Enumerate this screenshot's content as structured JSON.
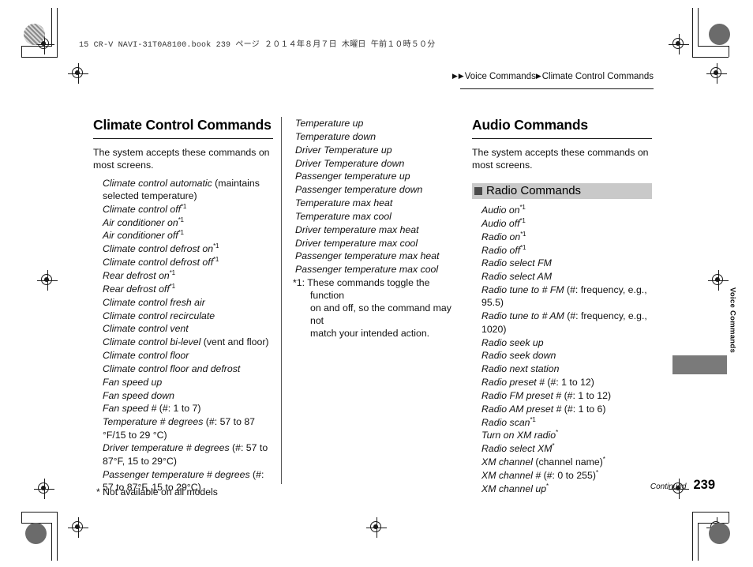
{
  "print_marks": {
    "filename_bar": "15 CR-V NAVI-31T0A8100.book   239 ページ   ２０１４年８月７日   木曜日   午前１０時５０分"
  },
  "breadcrumb": {
    "arrow": "▶",
    "parent": "Voice Commands",
    "current": "Climate Control Commands"
  },
  "side_tab": {
    "label": "Voice Commands"
  },
  "footer": {
    "continued": "Continued",
    "page_number": "239"
  },
  "bottom_note": "* Not available on all models",
  "columns": {
    "left": {
      "title": "Climate Control Commands",
      "intro": "The system accepts these commands on most screens.",
      "items": [
        {
          "cmd": "Climate control automatic",
          "note": " (maintains selected temperature)",
          "mark": ""
        },
        {
          "cmd": "Climate control off",
          "note": "",
          "mark": "*1"
        },
        {
          "cmd": "Air conditioner on",
          "note": "",
          "mark": "*1"
        },
        {
          "cmd": "Air conditioner off",
          "note": "",
          "mark": "*1"
        },
        {
          "cmd": "Climate control defrost on",
          "note": "",
          "mark": "*1"
        },
        {
          "cmd": "Climate control defrost off",
          "note": "",
          "mark": "*1"
        },
        {
          "cmd": "Rear defrost on",
          "note": "",
          "mark": "*1"
        },
        {
          "cmd": "Rear defrost off",
          "note": "",
          "mark": "*1"
        },
        {
          "cmd": "Climate control fresh air",
          "note": "",
          "mark": ""
        },
        {
          "cmd": "Climate control recirculate",
          "note": "",
          "mark": ""
        },
        {
          "cmd": "Climate control vent",
          "note": "",
          "mark": ""
        },
        {
          "cmd": "Climate control bi-level",
          "note": " (vent and floor)",
          "mark": ""
        },
        {
          "cmd": "Climate control floor",
          "note": "",
          "mark": ""
        },
        {
          "cmd": "Climate control floor and defrost",
          "note": "",
          "mark": ""
        },
        {
          "cmd": "Fan speed up",
          "note": "",
          "mark": ""
        },
        {
          "cmd": "Fan speed down",
          "note": "",
          "mark": ""
        },
        {
          "cmd": "Fan speed #",
          "note": " (#: 1 to 7)",
          "mark": ""
        },
        {
          "cmd": "Temperature # degrees",
          "note": " (#: 57 to 87 °F/15 to 29 °C)",
          "mark": ""
        },
        {
          "cmd": "Driver temperature # degrees",
          "note": " (#: 57 to 87°F, 15 to 29°C)",
          "mark": ""
        },
        {
          "cmd": "Passenger temperature # degrees",
          "note": " (#: 57 to 87°F, 15 to 29°C)",
          "mark": ""
        }
      ]
    },
    "middle": {
      "items": [
        {
          "cmd": "Temperature up",
          "note": "",
          "mark": ""
        },
        {
          "cmd": "Temperature down",
          "note": "",
          "mark": ""
        },
        {
          "cmd": "Driver Temperature up",
          "note": "",
          "mark": ""
        },
        {
          "cmd": "Driver Temperature down",
          "note": "",
          "mark": ""
        },
        {
          "cmd": "Passenger temperature up",
          "note": "",
          "mark": ""
        },
        {
          "cmd": "Passenger temperature down",
          "note": "",
          "mark": ""
        },
        {
          "cmd": "Temperature max heat",
          "note": "",
          "mark": ""
        },
        {
          "cmd": "Temperature max cool",
          "note": "",
          "mark": ""
        },
        {
          "cmd": "Driver temperature max heat",
          "note": "",
          "mark": ""
        },
        {
          "cmd": "Driver temperature max cool",
          "note": "",
          "mark": ""
        },
        {
          "cmd": "Passenger temperature max heat",
          "note": "",
          "mark": ""
        },
        {
          "cmd": "Passenger temperature max cool",
          "note": "",
          "mark": ""
        }
      ],
      "footnote_label": "*1:",
      "footnote_line1": "These commands toggle the function",
      "footnote_line2": "on and off, so the command may not",
      "footnote_line3": "match your intended action."
    },
    "right": {
      "title": "Audio Commands",
      "intro": "The system accepts these commands on most screens.",
      "subsection": "Radio Commands",
      "items": [
        {
          "cmd": "Audio on",
          "note": "",
          "mark": "*1"
        },
        {
          "cmd": "Audio off",
          "note": "",
          "mark": "*1"
        },
        {
          "cmd": "Radio on",
          "note": "",
          "mark": "*1"
        },
        {
          "cmd": "Radio off",
          "note": "",
          "mark": "*1"
        },
        {
          "cmd": "Radio select FM",
          "note": "",
          "mark": ""
        },
        {
          "cmd": "Radio select AM",
          "note": "",
          "mark": ""
        },
        {
          "cmd": "Radio tune to # FM",
          "note": " (#: frequency, e.g., 95.5)",
          "mark": ""
        },
        {
          "cmd": "Radio tune to # AM",
          "note": " (#: frequency, e.g., 1020)",
          "mark": ""
        },
        {
          "cmd": "Radio seek up",
          "note": "",
          "mark": ""
        },
        {
          "cmd": "Radio seek down",
          "note": "",
          "mark": ""
        },
        {
          "cmd": "Radio next station",
          "note": "",
          "mark": ""
        },
        {
          "cmd": "Radio preset #",
          "note": " (#: 1 to 12)",
          "mark": ""
        },
        {
          "cmd": "Radio FM preset #",
          "note": " (#: 1 to 12)",
          "mark": ""
        },
        {
          "cmd": "Radio AM preset #",
          "note": " (#: 1 to 6)",
          "mark": ""
        },
        {
          "cmd": "Radio scan",
          "note": "",
          "mark": "*1"
        },
        {
          "cmd": "Turn on XM radio",
          "note": "",
          "mark": "*"
        },
        {
          "cmd": "Radio select XM",
          "note": "",
          "mark": "*"
        },
        {
          "cmd": "XM channel",
          "note": " (channel name)",
          "mark": "*",
          "mark_after_note": true
        },
        {
          "cmd": "XM channel #",
          "note": " (#: 0 to 255)",
          "mark": "*",
          "mark_after_note": true
        },
        {
          "cmd": "XM channel up",
          "note": "",
          "mark": "*"
        }
      ]
    }
  }
}
